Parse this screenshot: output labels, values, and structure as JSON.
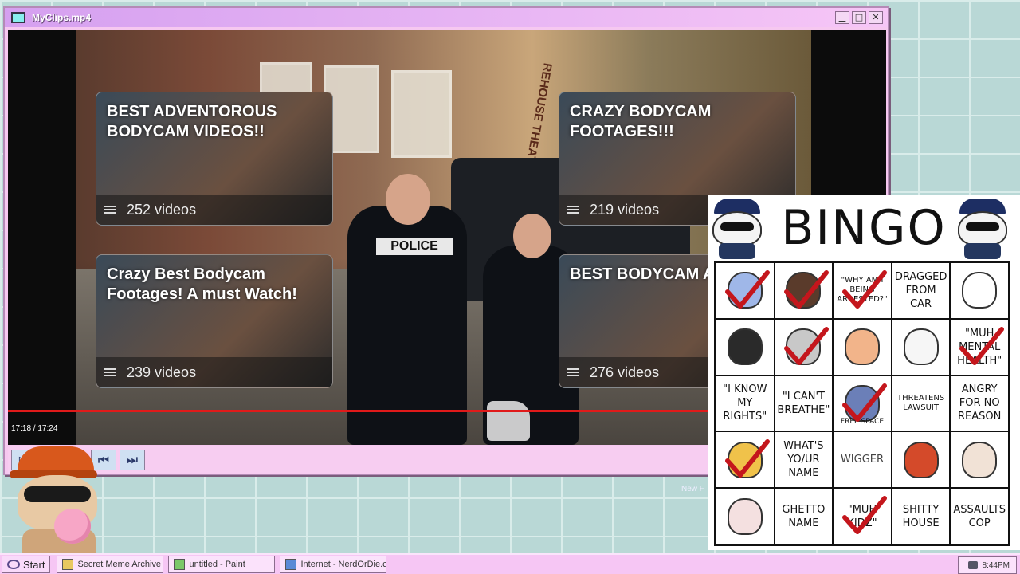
{
  "window": {
    "title": "MyClips.mp4",
    "buttons": {
      "minimize": "▁",
      "maximize": "□",
      "close": "✕"
    }
  },
  "video": {
    "cards": [
      {
        "title": "BEST ADVENTOROUS BODYCAM VIDEOS!!",
        "count": "252 videos"
      },
      {
        "title": "CRAZY BODYCAM FOOTAGES!!!",
        "count": "219 videos"
      },
      {
        "title": "Crazy Best Bodycam Footages! A must Watch!",
        "count": "239 videos"
      },
      {
        "title": "BEST BODYCAM A EVER!!",
        "count": "276 videos"
      }
    ],
    "patch_text": "POLICE",
    "sign_text": "REHOUSE THEATER",
    "timecode": "17:18 / 17:24",
    "progress_fraction": 0.997
  },
  "controls": {
    "play": "▷",
    "prev": "⏮",
    "next": "⏭"
  },
  "bingo": {
    "title": "BINGO",
    "cells": [
      {
        "text": "",
        "art": "cat-avatar",
        "color": "#9fb7e8",
        "checked": true
      },
      {
        "text": "",
        "art": "woman-avatar",
        "color": "#5a3b2b",
        "checked": true
      },
      {
        "text": "\"WHY AM I BEING ARRESTED?\"",
        "small": true,
        "checked": true
      },
      {
        "text": "DRAGGED FROM CAR",
        "checked": false
      },
      {
        "text": "",
        "art": "stickman",
        "color": "#ffffff",
        "checked": false
      },
      {
        "text": "",
        "art": "emo-cat",
        "color": "#2a2a2a",
        "checked": false
      },
      {
        "text": "",
        "art": "raccoon-cat",
        "color": "#c8c8c8",
        "checked": true
      },
      {
        "text": "",
        "art": "nerd-kid",
        "color": "#f2b48a",
        "checked": false
      },
      {
        "text": "",
        "art": "fat-cat",
        "color": "#f6f6f6",
        "checked": false
      },
      {
        "text": "\"MUH MENTAL HEALTH\"",
        "checked": true
      },
      {
        "text": "\"I KNOW MY RIGHTS\"",
        "checked": false
      },
      {
        "text": "\"I CAN'T BREATHE\"",
        "checked": false
      },
      {
        "text": "",
        "art": "flag-cat",
        "color": "#6b7fb8",
        "checked": true,
        "free": "FREE SPACE"
      },
      {
        "text": "THREATENS LAWSUIT",
        "small": true,
        "checked": false
      },
      {
        "text": "ANGRY FOR NO REASON",
        "checked": false
      },
      {
        "text": "",
        "art": "clown-cat",
        "color": "#f0c24a",
        "checked": true
      },
      {
        "text": "WHAT'S YO/UR NAME",
        "checked": false
      },
      {
        "text": "WIGGER",
        "gray": true,
        "checked": false
      },
      {
        "text": "",
        "art": "scarf-cat",
        "color": "#d44a2a",
        "checked": false
      },
      {
        "text": "",
        "art": "happy-cat",
        "color": "#f1e2d6",
        "checked": false
      },
      {
        "text": "",
        "art": "sitting-cat",
        "color": "#f4e0e0",
        "checked": false
      },
      {
        "text": "GHETTO NAME",
        "checked": false
      },
      {
        "text": "\"MUH KIDZ\"",
        "checked": true
      },
      {
        "text": "SHITTY HOUSE",
        "checked": false
      },
      {
        "text": "ASSAULTS COP",
        "checked": false
      }
    ],
    "check_color": "#c4161c"
  },
  "desktop": {
    "partial_label": "New F"
  },
  "taskbar": {
    "start": "Start",
    "tasks": [
      {
        "label": "Secret Meme Archive",
        "icon": "folder-icon",
        "color": "#e8c860"
      },
      {
        "label": "untitled - Paint",
        "icon": "paint-icon",
        "color": "#7bc86a"
      },
      {
        "label": "Internet - NerdOrDie.com",
        "icon": "globe-icon",
        "color": "#5b8ad6"
      }
    ],
    "clock": "8:44PM"
  }
}
